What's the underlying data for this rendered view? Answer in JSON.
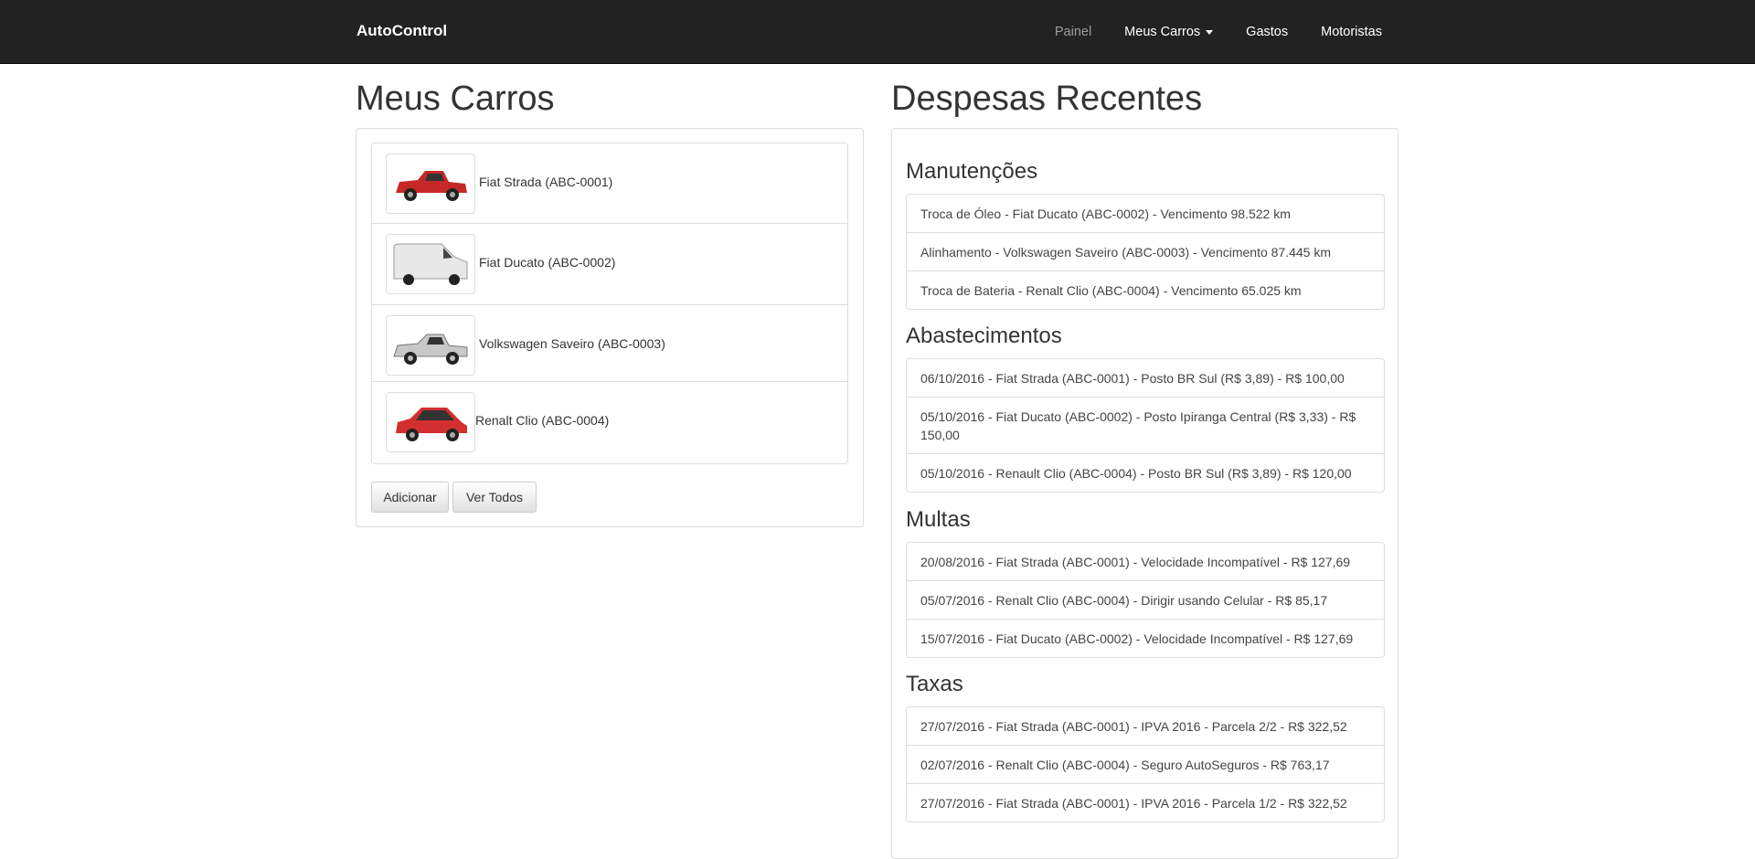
{
  "navbar": {
    "brand": "AutoControl",
    "items": [
      {
        "label": "Painel"
      },
      {
        "label": "Meus Carros"
      },
      {
        "label": "Gastos"
      },
      {
        "label": "Motoristas"
      }
    ]
  },
  "cars": {
    "title": "Meus Carros",
    "items": [
      {
        "label": "Fiat Strada (ABC-0001)",
        "color": "#c62828"
      },
      {
        "label": "Fiat Ducato (ABC-0002)",
        "color": "#e8e8e8"
      },
      {
        "label": "Volkswagen Saveiro (ABC-0003)",
        "color": "#c8c8c8"
      },
      {
        "label": "Renalt Clio (ABC-0004)",
        "color": "#d32f2f"
      }
    ],
    "add_label": "Adicionar",
    "view_all_label": "Ver Todos"
  },
  "expenses": {
    "title": "Despesas Recentes",
    "maintenance": {
      "title": "Manutenções",
      "items": [
        "Troca de Óleo - Fiat Ducato (ABC-0002) - Vencimento 98.522 km",
        "Alinhamento - Volkswagen Saveiro (ABC-0003) - Vencimento 87.445 km",
        "Troca de Bateria - Renalt Clio (ABC-0004) - Vencimento 65.025 km"
      ]
    },
    "fuel": {
      "title": "Abastecimentos",
      "items": [
        "06/10/2016 - Fiat Strada (ABC-0001) - Posto BR Sul (R$ 3,89) - R$ 100,00",
        "05/10/2016 - Fiat Ducato (ABC-0002) - Posto Ipiranga Central (R$ 3,33) - R$ 150,00",
        "05/10/2016 - Renault Clio (ABC-0004) - Posto BR Sul (R$ 3,89) - R$ 120,00"
      ]
    },
    "fines": {
      "title": "Multas",
      "items": [
        "20/08/2016 - Fiat Strada (ABC-0001) - Velocidade Incompatível - R$ 127,69",
        "05/07/2016 - Renalt Clio (ABC-0004) - Dirigir usando Celular - R$ 85,17",
        "15/07/2016 - Fiat Ducato (ABC-0002) - Velocidade Incompatível - R$ 127,69"
      ]
    },
    "fees": {
      "title": "Taxas",
      "items": [
        "27/07/2016 - Fiat Strada (ABC-0001) - IPVA 2016 - Parcela 2/2 - R$ 322,52",
        "02/07/2016 - Renalt Clio (ABC-0004) - Seguro AutoSeguros - R$ 763,17",
        "27/07/2016 - Fiat Strada (ABC-0001) - IPVA 2016 - Parcela 1/2 - R$ 322,52"
      ]
    }
  }
}
